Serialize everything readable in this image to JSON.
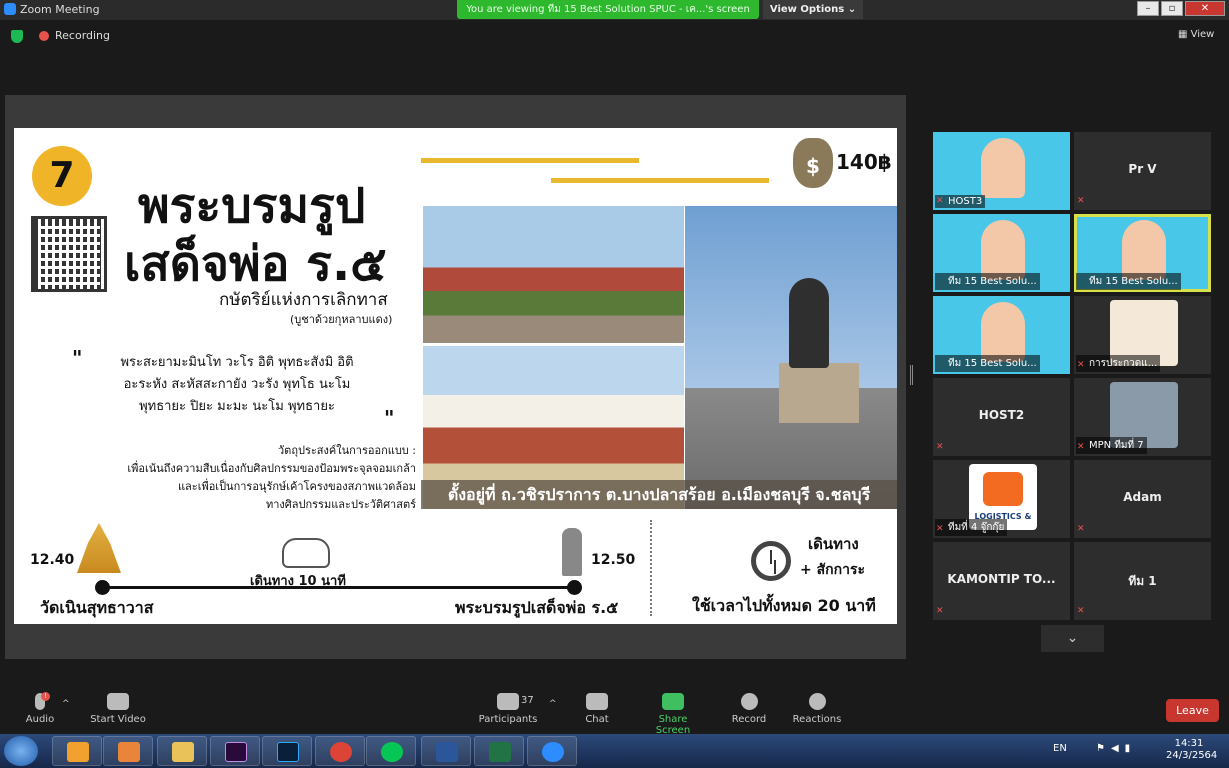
{
  "window": {
    "title": "Zoom Meeting"
  },
  "banner": {
    "text": "You are viewing ทีม 15 Best Solution SPUC - เค...'s screen"
  },
  "view_options": {
    "label": "View Options ⌄"
  },
  "window_buttons": [
    "–",
    "▫",
    "✕"
  ],
  "recording": {
    "label": "Recording"
  },
  "view_button": {
    "label": "▦ View"
  },
  "slide": {
    "number": "7",
    "title_line1": "พระบรมรูป",
    "title_line2": "เสด็จพ่อ ร.๕",
    "subtitle": "กษัตริย์แห่งการเลิกทาส",
    "subnote": "(บูชาด้วยกุหลาบแดง)",
    "quote_open": "\"",
    "quote_close": "\"",
    "chant_line1": "พระสะยามะมินโท วะโร อิติ พุทธะสังมิ อิติ",
    "chant_line2": "อะระหัง สะหัสสะกายัง วะรัง พุทโธ นะโม",
    "chant_line3": "พุทธายะ ปิยะ มะมะ นะโม พุทธายะ",
    "objective_title": "วัตถุประสงค์ในการออกแบบ :",
    "objective_line1": "เพื่อเน้นถึงความสืบเนื่องกับศิลปกรรมของป้อมพระจุลจอมเกล้า",
    "objective_line2": "และเพื่อเป็นการอนุรักษ์เค้าโครงของสภาพแวดล้อม",
    "objective_line3": "ทางศิลปกรรมและประวัติศาสตร์",
    "price": "140฿",
    "money_symbol": "$",
    "location": "ตั้งอยู่ที่ ถ.วชิรปราการ ต.บางปลาสร้อย อ.เมืองชลบุรี จ.ชลบุรี",
    "time_start": "12.40",
    "time_end": "12.50",
    "walk_label": "เดินทาง 10 นาที",
    "place_start": "วัดเนินสุทธาวาส",
    "place_end": "พระบรมรูปเสด็จพ่อ ร.๕",
    "depart_label": "เดินทาง",
    "visit_label": "+ สักการะ",
    "total_label": "ใช้เวลาไปทั้งหมด 20 นาที"
  },
  "gallery": {
    "tiles": [
      {
        "caption": "HOST3",
        "name": ""
      },
      {
        "caption": "",
        "name": "Pr V"
      },
      {
        "caption": "ทีม 15 Best Solu...",
        "name": ""
      },
      {
        "caption": "ทีม 15 Best Solu...",
        "name": ""
      },
      {
        "caption": "ทีม 15 Best Solu...",
        "name": ""
      },
      {
        "caption": "การประกวดแ...",
        "name": ""
      },
      {
        "caption": "",
        "name": "HOST2"
      },
      {
        "caption": "MPN ทีมที่ 7",
        "name": ""
      },
      {
        "caption": "ทีมที่ 4 จู๊กกุ๊ย",
        "name": ""
      },
      {
        "caption": "",
        "name": "Adam"
      },
      {
        "caption": "",
        "name": "KAMONTIP TO..."
      },
      {
        "caption": "",
        "name": "ทีม 1"
      }
    ],
    "logo_text": "LOGISTICS &",
    "scroll_label": "⌄"
  },
  "toolbar": {
    "audio": "Audio",
    "start_video": "Start Video",
    "participants": "Participants",
    "participants_count": "37",
    "chat": "Chat",
    "share_screen": "Share Screen",
    "record": "Record",
    "reactions": "Reactions",
    "leave": "Leave",
    "audio_badge": "!"
  },
  "taskbar": {
    "lang": "EN",
    "time": "14:31",
    "date": "24/3/2564",
    "apps": [
      "C",
      "▶",
      "📁",
      "Pr",
      "Ps",
      "G",
      "LINE",
      "W",
      "X",
      "Z"
    ]
  },
  "colors": {
    "accent_gold": "#f0b429",
    "leave_red": "#c7372f",
    "share_green": "#3fbf5f",
    "banner_green": "#2eb82e",
    "tile_cyan": "#48c7e9"
  }
}
